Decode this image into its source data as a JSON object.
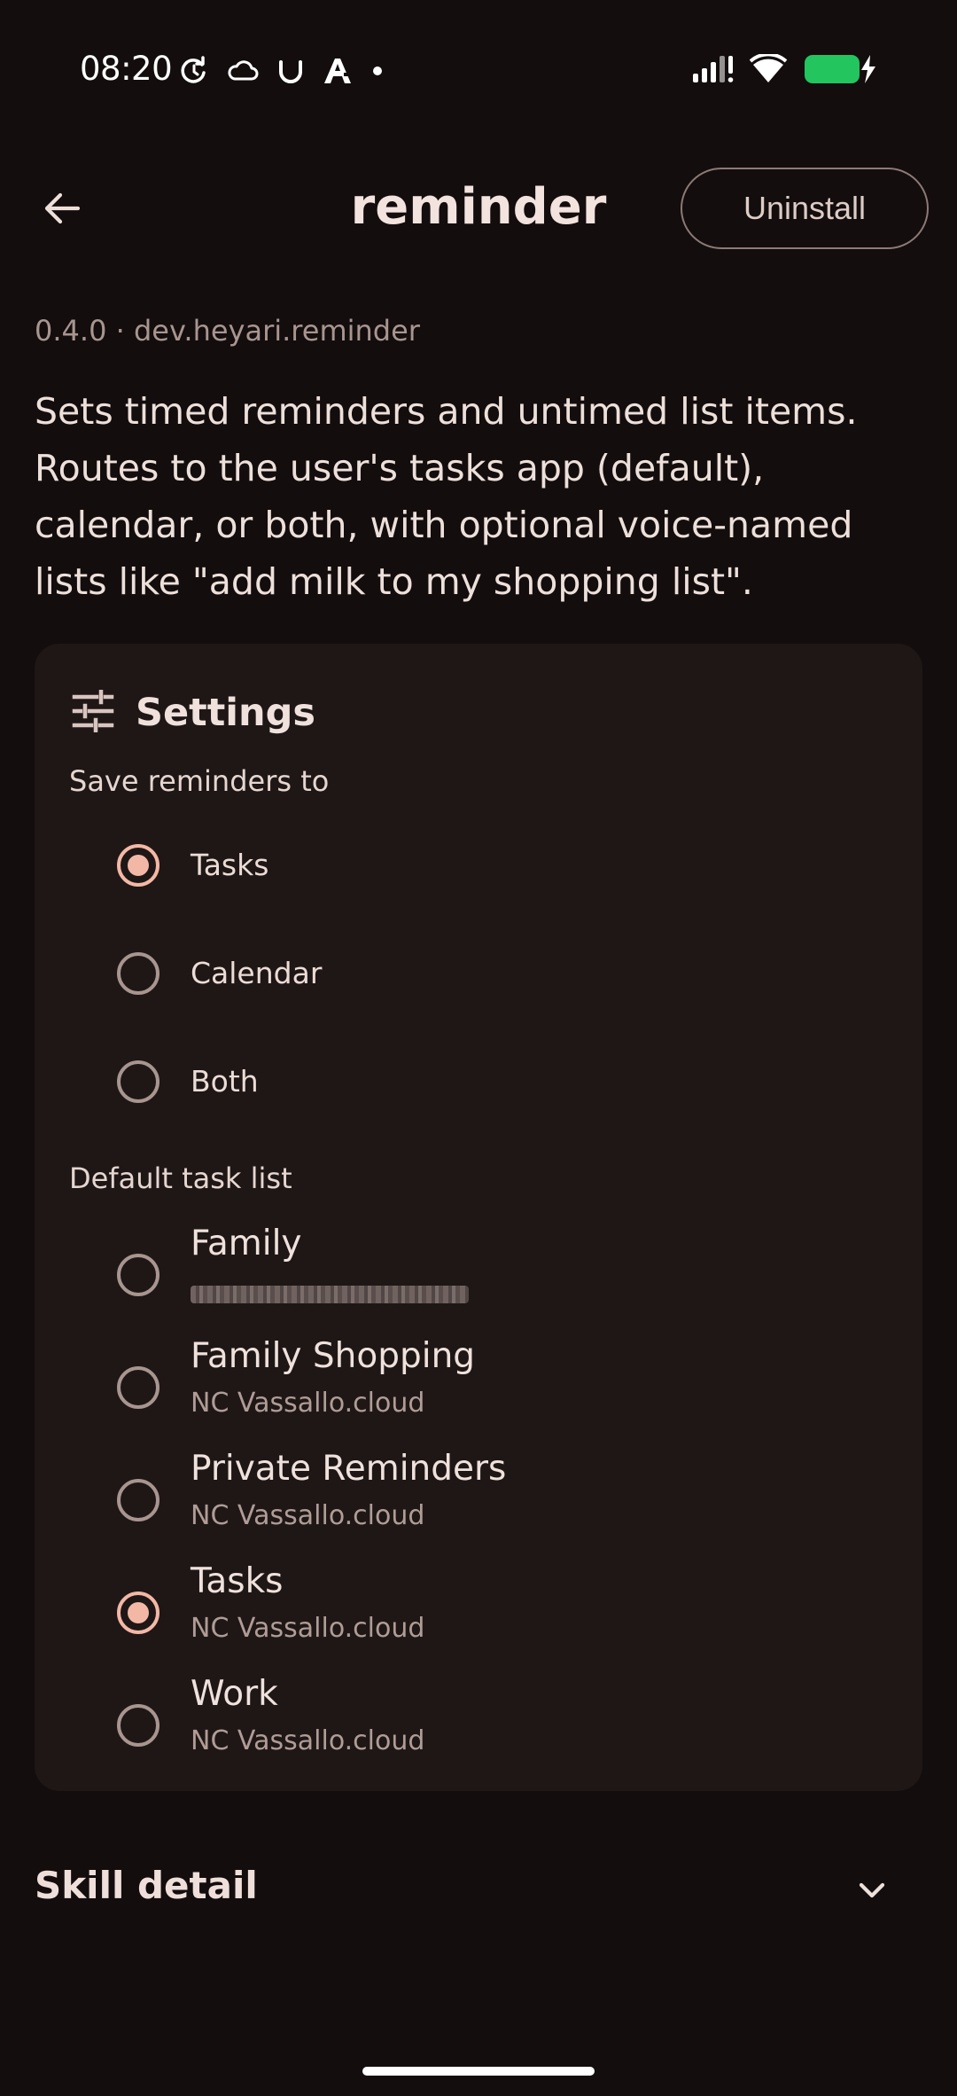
{
  "status_bar": {
    "time": "08:20",
    "icons_left": [
      "sync-icon",
      "cloud-icon",
      "magnet-icon",
      "font-a-icon",
      "dot-icon"
    ],
    "icons_right": [
      "signal-icon",
      "wifi-icon",
      "battery-charging-icon"
    ],
    "battery_color": "#22c55e"
  },
  "header": {
    "title": "reminder",
    "uninstall_label": "Uninstall",
    "back_icon": "arrow-left-icon"
  },
  "app_info": {
    "version_line": "0.4.0 · dev.heyari.reminder",
    "description": "Sets timed reminders and untimed list items. Routes to the user's tasks app (default), calendar, or both, with optional voice-named lists like \"add milk to my shopping list\"."
  },
  "settings": {
    "title": "Settings",
    "icon": "tune-sliders-icon",
    "save_section": {
      "label": "Save reminders to",
      "options": [
        {
          "label": "Tasks",
          "selected": true
        },
        {
          "label": "Calendar",
          "selected": false
        },
        {
          "label": "Both",
          "selected": false
        }
      ]
    },
    "task_list_section": {
      "label": "Default task list",
      "options": [
        {
          "title": "Family",
          "subtitle": "",
          "subtitle_redacted": true,
          "selected": false
        },
        {
          "title": "Family Shopping",
          "subtitle": "NC Vassallo.cloud",
          "selected": false
        },
        {
          "title": "Private Reminders",
          "subtitle": "NC Vassallo.cloud",
          "selected": false
        },
        {
          "title": "Tasks",
          "subtitle": "NC Vassallo.cloud",
          "selected": true
        },
        {
          "title": "Work",
          "subtitle": "NC Vassallo.cloud",
          "selected": false
        }
      ]
    }
  },
  "skill_detail": {
    "label": "Skill detail",
    "icon": "chevron-down-icon"
  },
  "colors": {
    "background": "#130d0d",
    "card": "#1e1716",
    "accent": "#f3b8a5",
    "text": "#efe0da",
    "muted": "#a89590"
  }
}
